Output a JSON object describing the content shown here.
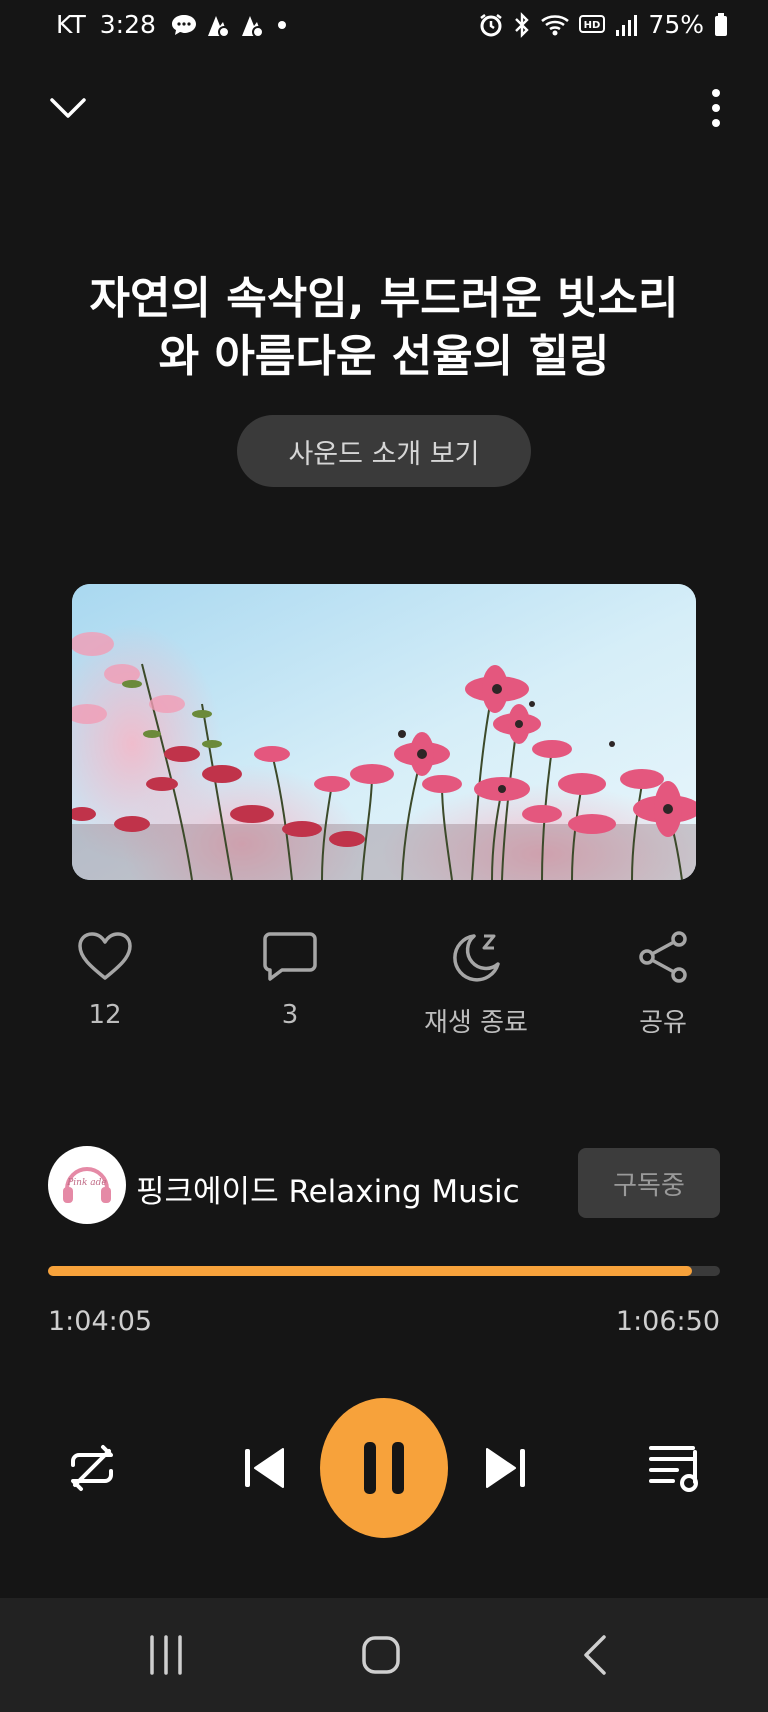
{
  "status": {
    "carrier": "KT",
    "time": "3:28",
    "battery": "75%"
  },
  "title": "자연의 속삭임, 부드러운 빗소리\n와 아름다운 선율의 힐링",
  "sound_intro_label": "사운드 소개 보기",
  "actions": {
    "like_count": "12",
    "comment_count": "3",
    "sleep_label": "재생 종료",
    "share_label": "공유"
  },
  "channel": {
    "name": "핑크에이드 Relaxing Music",
    "subscribe_label": "구독중",
    "avatar_text": "Pink ade"
  },
  "player": {
    "current_time": "1:04:05",
    "total_time": "1:06:50",
    "progress": 0.959
  },
  "colors": {
    "accent": "#f7a23b",
    "background": "#151515"
  }
}
